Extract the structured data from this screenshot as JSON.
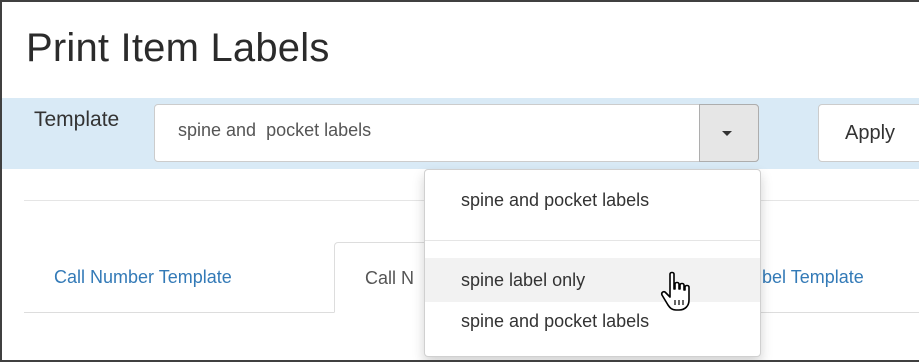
{
  "page": {
    "title": "Print Item Labels"
  },
  "template": {
    "label": "Template",
    "selected_value": "spine and  pocket labels",
    "apply_label": "Apply"
  },
  "dropdown": {
    "options": [
      "spine and pocket labels",
      "spine label only",
      "spine and pocket labels"
    ],
    "highlighted_index": 1
  },
  "tabs": [
    {
      "label": "Call Number Template"
    },
    {
      "label": "Call N"
    },
    {
      "label": "bel Template"
    }
  ],
  "colors": {
    "template_bar": "#d9eaf6",
    "link": "#337ab7",
    "highlight": "#f2f2f2"
  },
  "icons": {
    "dropdown_toggle": "caret-down-icon",
    "cursor": "hand-pointer-icon"
  }
}
